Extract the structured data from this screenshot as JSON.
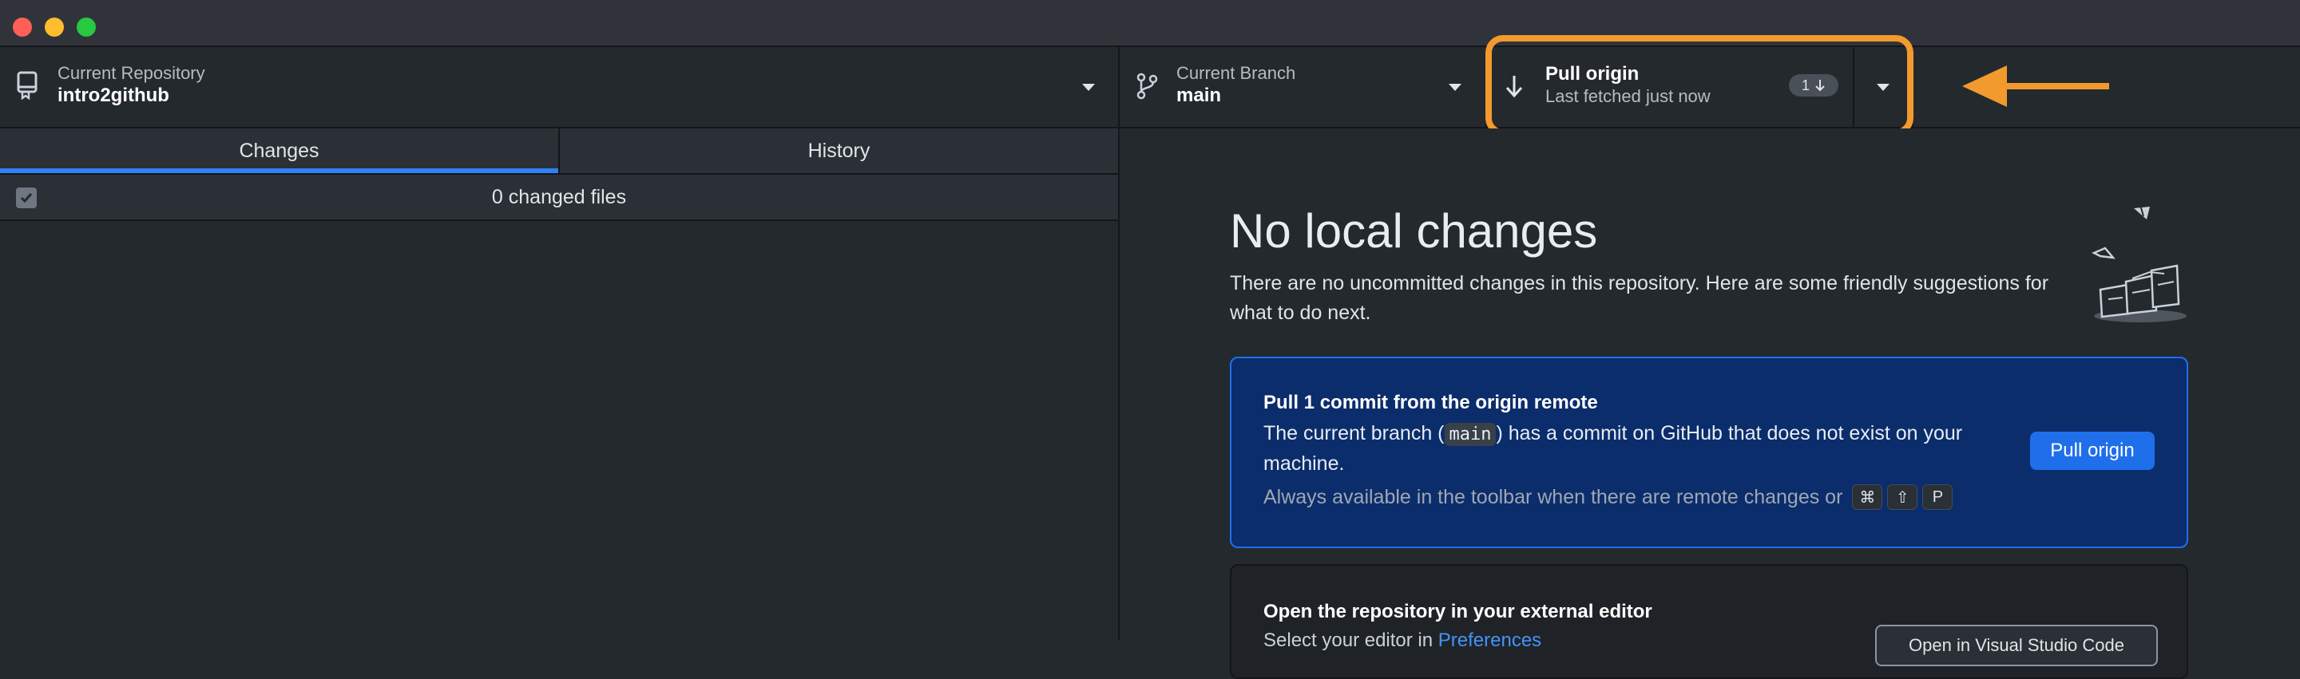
{
  "window": {
    "traffic_lights": {
      "close_color": "#ff5f57",
      "minimize_color": "#febc2e",
      "maximize_color": "#28c840"
    }
  },
  "toolbar": {
    "repository": {
      "label": "Current Repository",
      "value": "intro2github",
      "icon": "repository-icon"
    },
    "branch": {
      "label": "Current Branch",
      "value": "main",
      "icon": "git-branch-icon"
    },
    "pull": {
      "label": "Pull origin",
      "sublabel": "Last fetched just now",
      "badge_count": "1",
      "icon": "arrow-down-icon"
    }
  },
  "sidebar": {
    "tabs": [
      {
        "label": "Changes",
        "selected": true
      },
      {
        "label": "History",
        "selected": false
      }
    ],
    "changed_files_label": "0 changed files"
  },
  "main": {
    "heading": "No local changes",
    "description": "There are no uncommitted changes in this repository. Here are some friendly suggestions for what to do next.",
    "pull_card": {
      "title": "Pull 1 commit from the origin remote",
      "body_before": "The current branch (",
      "branch_code": "main",
      "body_after": ") has a commit on GitHub that does not exist on your machine.",
      "hint": "Always available in the toolbar when there are remote changes or",
      "shortcut_keys": [
        "⌘",
        "⇧",
        "P"
      ],
      "button_label": "Pull origin"
    },
    "editor_card": {
      "title": "Open the repository in your external editor",
      "subtitle_prefix": "Select your editor in",
      "subtitle_link": "Preferences",
      "button_label": "Open in Visual Studio Code"
    }
  },
  "annotation": {
    "color": "#f29a2e"
  }
}
